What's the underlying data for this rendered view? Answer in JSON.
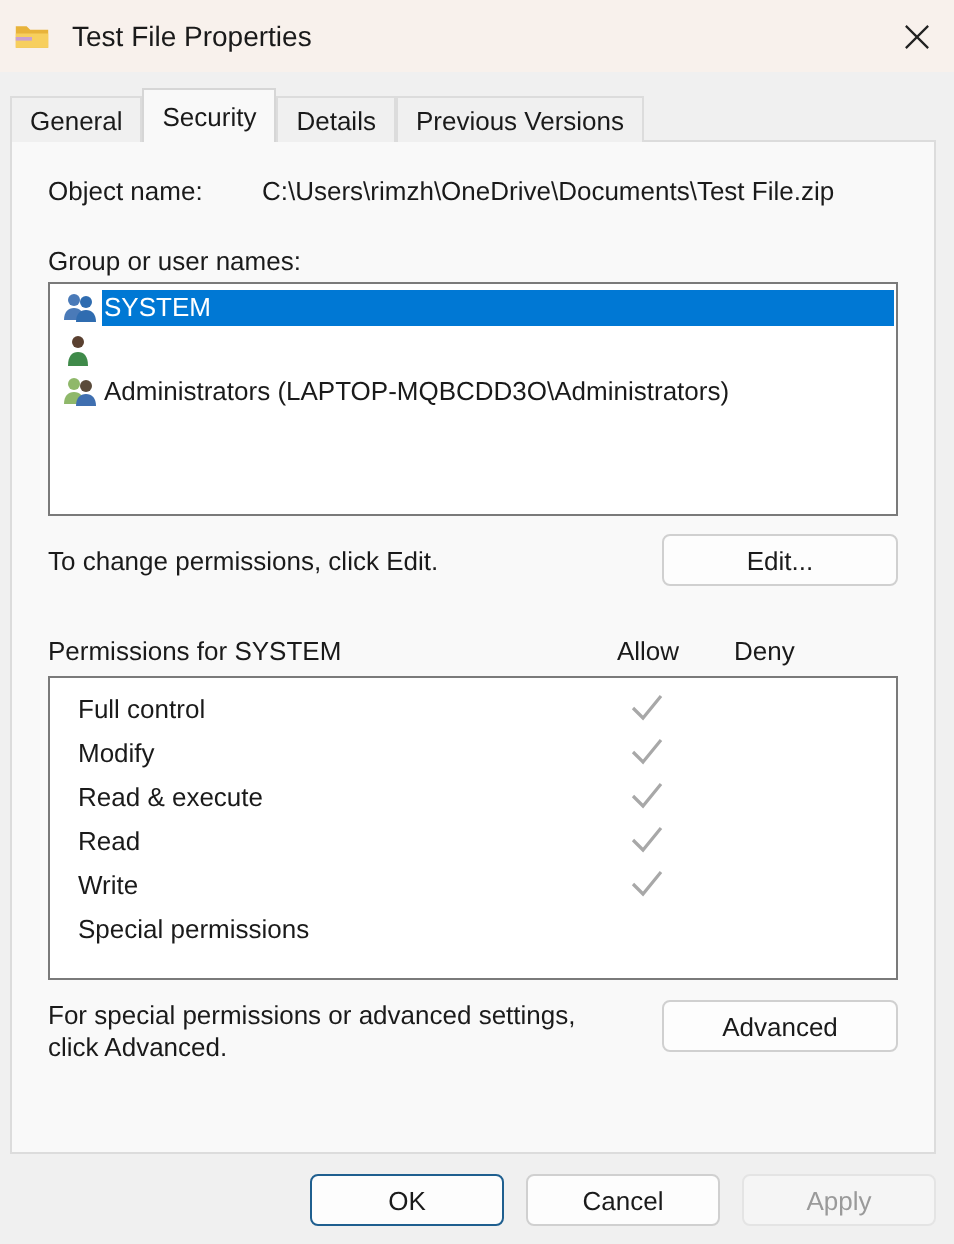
{
  "window": {
    "title": "Test File Properties"
  },
  "tabs": [
    {
      "label": "General",
      "selected": false
    },
    {
      "label": "Security",
      "selected": true
    },
    {
      "label": "Details",
      "selected": false
    },
    {
      "label": "Previous Versions",
      "selected": false
    }
  ],
  "object_name": {
    "label": "Object name:",
    "value": "C:\\Users\\rimzh\\OneDrive\\Documents\\Test File.zip"
  },
  "group_label": "Group or user names:",
  "users": [
    {
      "kind": "group",
      "name": "SYSTEM",
      "selected": true
    },
    {
      "kind": "user",
      "selected": false
    },
    {
      "kind": "group2",
      "name": "Administrators (LAPTOP-MQBCDD3O\\Administrators)",
      "selected": false
    }
  ],
  "edit_hint": "To change permissions, click Edit.",
  "edit_button": "Edit...",
  "permissions": {
    "title": "Permissions for SYSTEM",
    "allow_label": "Allow",
    "deny_label": "Deny",
    "rows": [
      {
        "name": "Full control",
        "allow": true,
        "deny": false
      },
      {
        "name": "Modify",
        "allow": true,
        "deny": false
      },
      {
        "name": "Read & execute",
        "allow": true,
        "deny": false
      },
      {
        "name": "Read",
        "allow": true,
        "deny": false
      },
      {
        "name": "Write",
        "allow": true,
        "deny": false
      },
      {
        "name": "Special permissions",
        "allow": false,
        "deny": false
      }
    ]
  },
  "advanced_hint": "For special permissions or advanced settings, click Advanced.",
  "advanced_button": "Advanced",
  "buttons": [
    {
      "label": "OK",
      "default": true,
      "disabled": false
    },
    {
      "label": "Cancel",
      "default": false,
      "disabled": false
    },
    {
      "label": "Apply",
      "default": false,
      "disabled": true
    }
  ]
}
